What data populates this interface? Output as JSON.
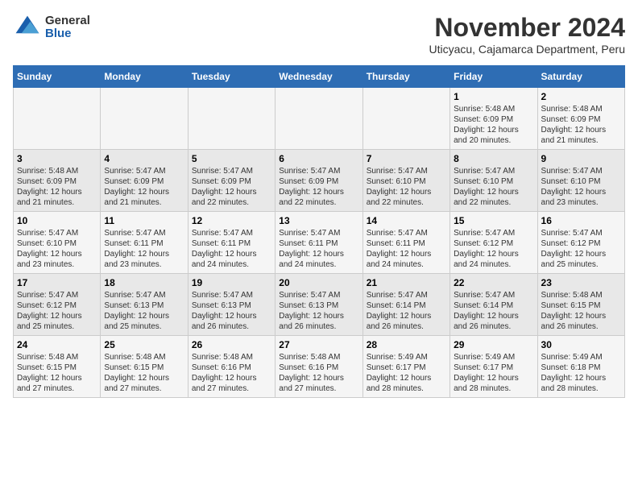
{
  "logo": {
    "general": "General",
    "blue": "Blue"
  },
  "title": "November 2024",
  "location": "Uticyacu, Cajamarca Department, Peru",
  "days_header": [
    "Sunday",
    "Monday",
    "Tuesday",
    "Wednesday",
    "Thursday",
    "Friday",
    "Saturday"
  ],
  "weeks": [
    [
      {
        "day": "",
        "info": ""
      },
      {
        "day": "",
        "info": ""
      },
      {
        "day": "",
        "info": ""
      },
      {
        "day": "",
        "info": ""
      },
      {
        "day": "",
        "info": ""
      },
      {
        "day": "1",
        "info": "Sunrise: 5:48 AM\nSunset: 6:09 PM\nDaylight: 12 hours and 20 minutes."
      },
      {
        "day": "2",
        "info": "Sunrise: 5:48 AM\nSunset: 6:09 PM\nDaylight: 12 hours and 21 minutes."
      }
    ],
    [
      {
        "day": "3",
        "info": "Sunrise: 5:48 AM\nSunset: 6:09 PM\nDaylight: 12 hours and 21 minutes."
      },
      {
        "day": "4",
        "info": "Sunrise: 5:47 AM\nSunset: 6:09 PM\nDaylight: 12 hours and 21 minutes."
      },
      {
        "day": "5",
        "info": "Sunrise: 5:47 AM\nSunset: 6:09 PM\nDaylight: 12 hours and 22 minutes."
      },
      {
        "day": "6",
        "info": "Sunrise: 5:47 AM\nSunset: 6:09 PM\nDaylight: 12 hours and 22 minutes."
      },
      {
        "day": "7",
        "info": "Sunrise: 5:47 AM\nSunset: 6:10 PM\nDaylight: 12 hours and 22 minutes."
      },
      {
        "day": "8",
        "info": "Sunrise: 5:47 AM\nSunset: 6:10 PM\nDaylight: 12 hours and 22 minutes."
      },
      {
        "day": "9",
        "info": "Sunrise: 5:47 AM\nSunset: 6:10 PM\nDaylight: 12 hours and 23 minutes."
      }
    ],
    [
      {
        "day": "10",
        "info": "Sunrise: 5:47 AM\nSunset: 6:10 PM\nDaylight: 12 hours and 23 minutes."
      },
      {
        "day": "11",
        "info": "Sunrise: 5:47 AM\nSunset: 6:11 PM\nDaylight: 12 hours and 23 minutes."
      },
      {
        "day": "12",
        "info": "Sunrise: 5:47 AM\nSunset: 6:11 PM\nDaylight: 12 hours and 24 minutes."
      },
      {
        "day": "13",
        "info": "Sunrise: 5:47 AM\nSunset: 6:11 PM\nDaylight: 12 hours and 24 minutes."
      },
      {
        "day": "14",
        "info": "Sunrise: 5:47 AM\nSunset: 6:11 PM\nDaylight: 12 hours and 24 minutes."
      },
      {
        "day": "15",
        "info": "Sunrise: 5:47 AM\nSunset: 6:12 PM\nDaylight: 12 hours and 24 minutes."
      },
      {
        "day": "16",
        "info": "Sunrise: 5:47 AM\nSunset: 6:12 PM\nDaylight: 12 hours and 25 minutes."
      }
    ],
    [
      {
        "day": "17",
        "info": "Sunrise: 5:47 AM\nSunset: 6:12 PM\nDaylight: 12 hours and 25 minutes."
      },
      {
        "day": "18",
        "info": "Sunrise: 5:47 AM\nSunset: 6:13 PM\nDaylight: 12 hours and 25 minutes."
      },
      {
        "day": "19",
        "info": "Sunrise: 5:47 AM\nSunset: 6:13 PM\nDaylight: 12 hours and 26 minutes."
      },
      {
        "day": "20",
        "info": "Sunrise: 5:47 AM\nSunset: 6:13 PM\nDaylight: 12 hours and 26 minutes."
      },
      {
        "day": "21",
        "info": "Sunrise: 5:47 AM\nSunset: 6:14 PM\nDaylight: 12 hours and 26 minutes."
      },
      {
        "day": "22",
        "info": "Sunrise: 5:47 AM\nSunset: 6:14 PM\nDaylight: 12 hours and 26 minutes."
      },
      {
        "day": "23",
        "info": "Sunrise: 5:48 AM\nSunset: 6:15 PM\nDaylight: 12 hours and 26 minutes."
      }
    ],
    [
      {
        "day": "24",
        "info": "Sunrise: 5:48 AM\nSunset: 6:15 PM\nDaylight: 12 hours and 27 minutes."
      },
      {
        "day": "25",
        "info": "Sunrise: 5:48 AM\nSunset: 6:15 PM\nDaylight: 12 hours and 27 minutes."
      },
      {
        "day": "26",
        "info": "Sunrise: 5:48 AM\nSunset: 6:16 PM\nDaylight: 12 hours and 27 minutes."
      },
      {
        "day": "27",
        "info": "Sunrise: 5:48 AM\nSunset: 6:16 PM\nDaylight: 12 hours and 27 minutes."
      },
      {
        "day": "28",
        "info": "Sunrise: 5:49 AM\nSunset: 6:17 PM\nDaylight: 12 hours and 28 minutes."
      },
      {
        "day": "29",
        "info": "Sunrise: 5:49 AM\nSunset: 6:17 PM\nDaylight: 12 hours and 28 minutes."
      },
      {
        "day": "30",
        "info": "Sunrise: 5:49 AM\nSunset: 6:18 PM\nDaylight: 12 hours and 28 minutes."
      }
    ]
  ]
}
